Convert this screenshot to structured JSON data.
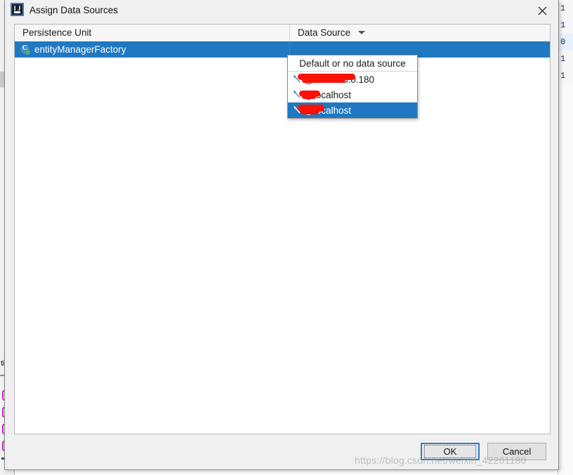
{
  "window": {
    "title": "Assign Data Sources",
    "app_icon": "intellij-idea-icon",
    "close_icon": "close-icon"
  },
  "table": {
    "columns": [
      {
        "label": "Persistence Unit",
        "sortable": false
      },
      {
        "label": "Data Source",
        "sortable": true,
        "caret_icon": "chevron-down-icon"
      }
    ],
    "rows": [
      {
        "persistence_unit": "entityManagerFactory",
        "icon": "class-icon",
        "data_source": "",
        "selected": true
      }
    ]
  },
  "dropdown": {
    "open": true,
    "items": [
      {
        "label": "Default or no data source",
        "icon": null,
        "selected": false,
        "header": true,
        "redacted": false
      },
      {
        "label": "@192.168.0.180",
        "icon": "database-icon",
        "selected": false,
        "header": false,
        "redacted": true
      },
      {
        "label": "@localhost",
        "icon": "database-icon",
        "selected": false,
        "header": false,
        "redacted": true
      },
      {
        "label": "@localhost",
        "icon": "database-icon",
        "selected": true,
        "header": false,
        "redacted": true
      }
    ]
  },
  "footer": {
    "ok_label": "OK",
    "cancel_label": "Cancel"
  },
  "watermark": {
    "text": "https://blog.csdn.net/weixin_42201180"
  },
  "background": {
    "editor_gutter_lines": [
      "1",
      "1",
      "0",
      "1",
      "1"
    ],
    "tool_window_tab": "ti"
  },
  "colors": {
    "selection_blue": "#1f78c1",
    "focus_blue": "#2f7fd0",
    "redaction_red": "#fc1106",
    "dialog_bg": "#f0f0f0"
  }
}
